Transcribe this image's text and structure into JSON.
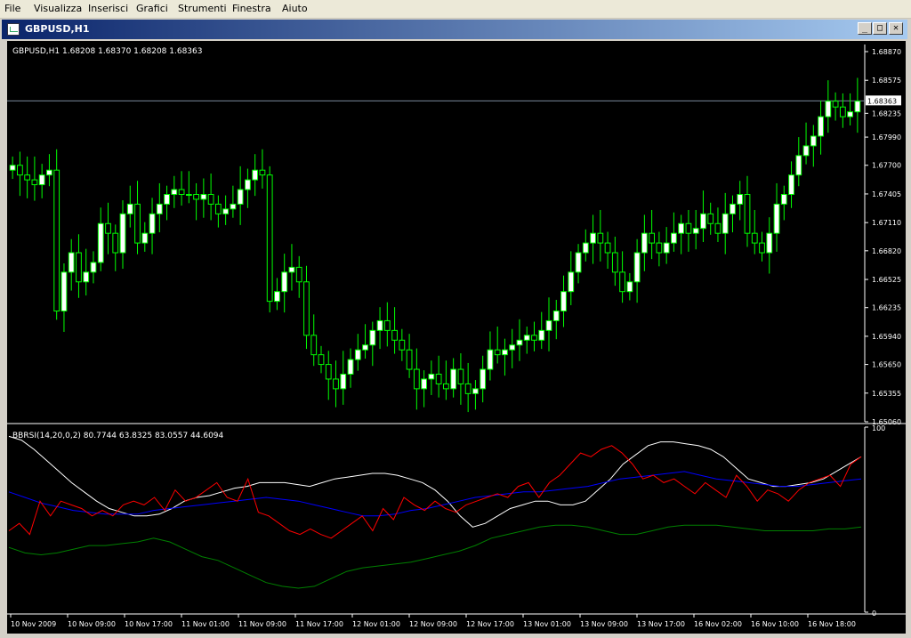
{
  "menu": [
    "File",
    "Visualizza",
    "Inserisci",
    "Grafici",
    "Strumenti",
    "Finestra",
    "Aiuto"
  ],
  "window": {
    "title": "GBPUSD,H1",
    "minimize": "_",
    "restore": "□",
    "close": "✕"
  },
  "chart_header": "GBPUSD,H1  1.68208 1.68370 1.68208 1.68363",
  "indicator_header": "BBRSI(14,20,0,2) 80.7744 63.8325 83.0557 44.6094",
  "colors": {
    "background": "#000000",
    "bull": "#ffffff",
    "bull_outline": "#00ff00",
    "wick": "#00ff00",
    "upper_band": "#ffffff",
    "middle_band": "#0000ff",
    "lower_band": "#008000",
    "rsi": "#ff0000"
  },
  "chart_data": [
    {
      "type": "candlestick",
      "symbol": "GBPUSD",
      "timeframe": "H1",
      "ylim": [
        1.6506,
        1.6887
      ],
      "yticks": [
        "1.68870",
        "1.68575",
        "1.68235",
        "1.67990",
        "1.67700",
        "1.67405",
        "1.67110",
        "1.66820",
        "1.66525",
        "1.66235",
        "1.65940",
        "1.65650",
        "1.65355",
        "1.65060"
      ],
      "current_price": "1.68363",
      "close_approx": [
        1.677,
        1.676,
        1.6755,
        1.675,
        1.676,
        1.6765,
        1.662,
        1.666,
        1.668,
        1.665,
        1.666,
        1.667,
        1.671,
        1.67,
        1.668,
        1.672,
        1.673,
        1.669,
        1.67,
        1.672,
        1.673,
        1.674,
        1.6745,
        1.674,
        1.674,
        1.6735,
        1.674,
        1.673,
        1.672,
        1.6725,
        1.673,
        1.6745,
        1.6755,
        1.6765,
        1.676,
        1.663,
        1.664,
        1.666,
        1.6665,
        1.665,
        1.6595,
        1.6575,
        1.6565,
        1.655,
        1.654,
        1.6555,
        1.657,
        1.658,
        1.6585,
        1.66,
        1.661,
        1.66,
        1.659,
        1.658,
        1.656,
        1.654,
        1.655,
        1.6555,
        1.6545,
        1.654,
        1.656,
        1.6545,
        1.6535,
        1.654,
        1.656,
        1.658,
        1.6575,
        1.658,
        1.6585,
        1.659,
        1.6595,
        1.659,
        1.66,
        1.661,
        1.662,
        1.664,
        1.666,
        1.668,
        1.669,
        1.67,
        1.669,
        1.668,
        1.666,
        1.664,
        1.665,
        1.668,
        1.67,
        1.669,
        1.668,
        1.669,
        1.67,
        1.671,
        1.67,
        1.6705,
        1.672,
        1.671,
        1.67,
        1.672,
        1.673,
        1.674,
        1.67,
        1.669,
        1.668,
        1.67,
        1.673,
        1.674,
        1.676,
        1.678,
        1.679,
        1.68,
        1.682,
        1.6836,
        1.683,
        1.682,
        1.6825,
        1.6836
      ],
      "xticks": [
        "10 Nov 2009",
        "10 Nov 09:00",
        "10 Nov 17:00",
        "11 Nov 01:00",
        "11 Nov 09:00",
        "11 Nov 17:00",
        "12 Nov 01:00",
        "12 Nov 09:00",
        "12 Nov 17:00",
        "13 Nov 01:00",
        "13 Nov 09:00",
        "13 Nov 17:00",
        "16 Nov 02:00",
        "16 Nov 10:00",
        "16 Nov 18:00"
      ]
    },
    {
      "type": "line",
      "indicator": "BBRSI(14,20,0,2)",
      "ylim": [
        0,
        100
      ],
      "yticks": [
        "100",
        "0"
      ],
      "series": [
        {
          "values": [
            95,
            93,
            88,
            82,
            76,
            70,
            65,
            60,
            56,
            54,
            52,
            52,
            53,
            56,
            60,
            62,
            63,
            65,
            67,
            68,
            70,
            70,
            70,
            69,
            68,
            70,
            72,
            73,
            74,
            75,
            75,
            74,
            72,
            70,
            66,
            60,
            52,
            46,
            48,
            52,
            56,
            58,
            60,
            60,
            58,
            58,
            60,
            66,
            72,
            80,
            85,
            90,
            92,
            92,
            91,
            90,
            88,
            84,
            78,
            72,
            70,
            68,
            68,
            69,
            70,
            72,
            76,
            80,
            84
          ]
        },
        {
          "values": [
            65,
            62,
            59,
            57,
            55,
            54,
            53,
            53,
            53,
            55,
            56,
            57,
            58,
            59,
            60,
            61,
            62,
            61,
            60,
            58,
            56,
            54,
            52,
            52,
            53,
            55,
            56,
            58,
            60,
            62,
            63,
            64,
            65,
            65,
            66,
            67,
            68,
            70,
            72,
            73,
            74,
            75,
            76,
            74,
            72,
            71,
            70,
            69,
            68,
            68,
            69,
            70,
            71,
            72
          ]
        },
        {
          "values": [
            35,
            32,
            31,
            32,
            34,
            36,
            36,
            37,
            38,
            40,
            38,
            34,
            30,
            28,
            24,
            20,
            16,
            14,
            13,
            14,
            18,
            22,
            24,
            25,
            26,
            27,
            29,
            31,
            33,
            36,
            40,
            42,
            44,
            46,
            47,
            47,
            46,
            44,
            42,
            42,
            44,
            46,
            47,
            47,
            47,
            46,
            45,
            44,
            44,
            44,
            44,
            45,
            45,
            46
          ]
        },
        {
          "values": [
            44,
            48,
            42,
            60,
            52,
            60,
            58,
            56,
            52,
            55,
            52,
            58,
            60,
            58,
            62,
            55,
            66,
            60,
            62,
            66,
            70,
            62,
            60,
            72,
            54,
            52,
            48,
            44,
            42,
            45,
            42,
            40,
            44,
            48,
            52,
            44,
            56,
            50,
            62,
            58,
            55,
            60,
            56,
            54,
            58,
            60,
            62,
            64,
            62,
            68,
            70,
            62,
            70,
            74,
            80,
            86,
            84,
            88,
            90,
            86,
            80,
            72,
            74,
            70,
            72,
            68,
            64,
            70,
            66,
            62,
            74,
            68,
            60,
            66,
            64,
            60,
            66,
            70,
            72,
            74,
            68,
            80,
            84
          ]
        }
      ]
    }
  ]
}
